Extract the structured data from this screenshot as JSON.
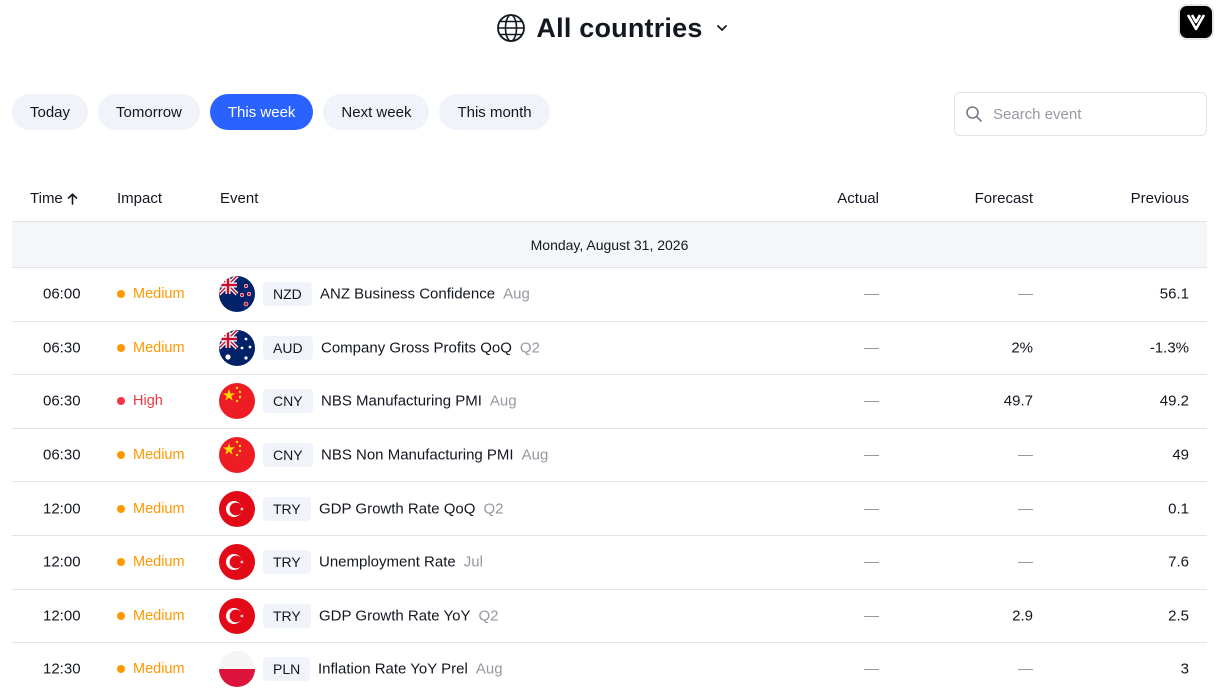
{
  "header": {
    "title": "All countries"
  },
  "tabs": [
    {
      "label": "Today"
    },
    {
      "label": "Tomorrow"
    },
    {
      "label": "This week",
      "active": true
    },
    {
      "label": "Next week"
    },
    {
      "label": "This month"
    }
  ],
  "search": {
    "placeholder": "Search event"
  },
  "table": {
    "columns": {
      "time": "Time",
      "impact": "Impact",
      "event": "Event",
      "actual": "Actual",
      "forecast": "Forecast",
      "previous": "Previous"
    },
    "date": "Monday, August 31, 2026",
    "rows": [
      {
        "time": "06:00",
        "impact": "Medium",
        "currency": "NZD",
        "name": "ANZ Business Confidence",
        "period": "Aug",
        "actual": "—",
        "forecast": "—",
        "previous": "56.1",
        "flag": "nz-flag"
      },
      {
        "time": "06:30",
        "impact": "Medium",
        "currency": "AUD",
        "name": "Company Gross Profits QoQ",
        "period": "Q2",
        "actual": "—",
        "forecast": "2%",
        "previous": "-1.3%",
        "flag": "au-flag"
      },
      {
        "time": "06:30",
        "impact": "High",
        "currency": "CNY",
        "name": "NBS Manufacturing PMI",
        "period": "Aug",
        "actual": "—",
        "forecast": "49.7",
        "previous": "49.2",
        "flag": "cn-flag"
      },
      {
        "time": "06:30",
        "impact": "Medium",
        "currency": "CNY",
        "name": "NBS Non Manufacturing PMI",
        "period": "Aug",
        "actual": "—",
        "forecast": "—",
        "previous": "49",
        "flag": "cn-flag"
      },
      {
        "time": "12:00",
        "impact": "Medium",
        "currency": "TRY",
        "name": "GDP Growth Rate QoQ",
        "period": "Q2",
        "actual": "—",
        "forecast": "—",
        "previous": "0.1",
        "flag": "tr-flag"
      },
      {
        "time": "12:00",
        "impact": "Medium",
        "currency": "TRY",
        "name": "Unemployment Rate",
        "period": "Jul",
        "actual": "—",
        "forecast": "—",
        "previous": "7.6",
        "flag": "tr-flag"
      },
      {
        "time": "12:00",
        "impact": "Medium",
        "currency": "TRY",
        "name": "GDP Growth Rate YoY",
        "period": "Q2",
        "actual": "—",
        "forecast": "2.9",
        "previous": "2.5",
        "flag": "tr-flag"
      },
      {
        "time": "12:30",
        "impact": "Medium",
        "currency": "PLN",
        "name": "Inflation Rate YoY Prel",
        "period": "Aug",
        "actual": "—",
        "forecast": "—",
        "previous": "3",
        "flag": "pl-flag"
      }
    ]
  },
  "colors": {
    "accent": "#2962ff",
    "medium": "#ff9800",
    "high": "#f23645",
    "muted": "#9598a1"
  }
}
